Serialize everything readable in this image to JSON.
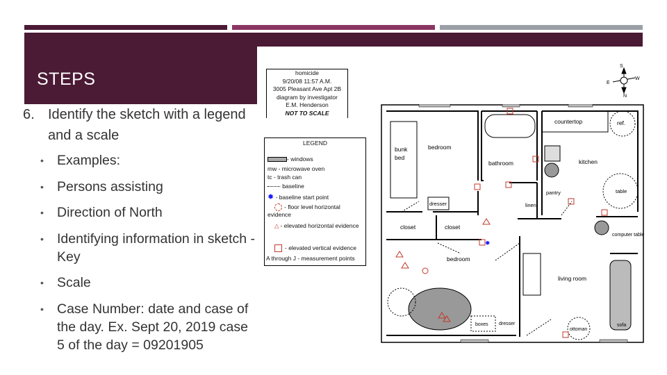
{
  "colors": {
    "dark": "#4b1a35",
    "accent": "#8b3563",
    "gray": "#9aa0a6",
    "evidence": "#c0392b",
    "start_point": "#1a1aff"
  },
  "title": "STEPS",
  "step": {
    "number": "6.",
    "text": "Identify the sketch with a legend and a scale"
  },
  "bullets": [
    "Examples:",
    "Persons assisting",
    "Direction of North",
    "Identifying information in sketch -Key",
    "Scale",
    "Case Number: date and case of the day. Ex. Sept 20, 2019 case 5 of the day = 09201905"
  ],
  "info_box": {
    "lines": [
      "homicide",
      "9/20/08 11:57 A.M.",
      "3005 Pleasant Ave Apt 2B",
      "diagram by investigator",
      "E.M. Henderson"
    ],
    "scale_note": "NOT TO SCALE"
  },
  "legend": {
    "title": "LEGEND",
    "items": [
      "- windows",
      "mw - microwave oven",
      "tc - trash can",
      "- baseline",
      "- baseline start point",
      "- floor level horizontal evidence",
      "- elevated horizontal evidence",
      "- elevated vertical evidence",
      "A through J - measurement points"
    ]
  },
  "compass": {
    "n": "N",
    "s": "S",
    "e": "E",
    "w": "W"
  },
  "floor_plan": {
    "rooms": {
      "bedroom1": "bedroom",
      "bathroom": "bathroom",
      "kitchen": "kitchen",
      "countertop": "countertop",
      "ref": "ref.",
      "bunk_bed_1": "bunk",
      "bunk_bed_2": "bed",
      "dresser": "dresser",
      "closet1": "closet",
      "closet2": "closet",
      "bedroom2": "bedroom",
      "living_room": "living room",
      "pantry": "pantry",
      "table": "table",
      "computer_table": "computer table",
      "sofa": "sofa",
      "ottoman": "ottoman",
      "boxes": "boxes",
      "linen": "linen",
      "dresser2": "dresser"
    }
  }
}
